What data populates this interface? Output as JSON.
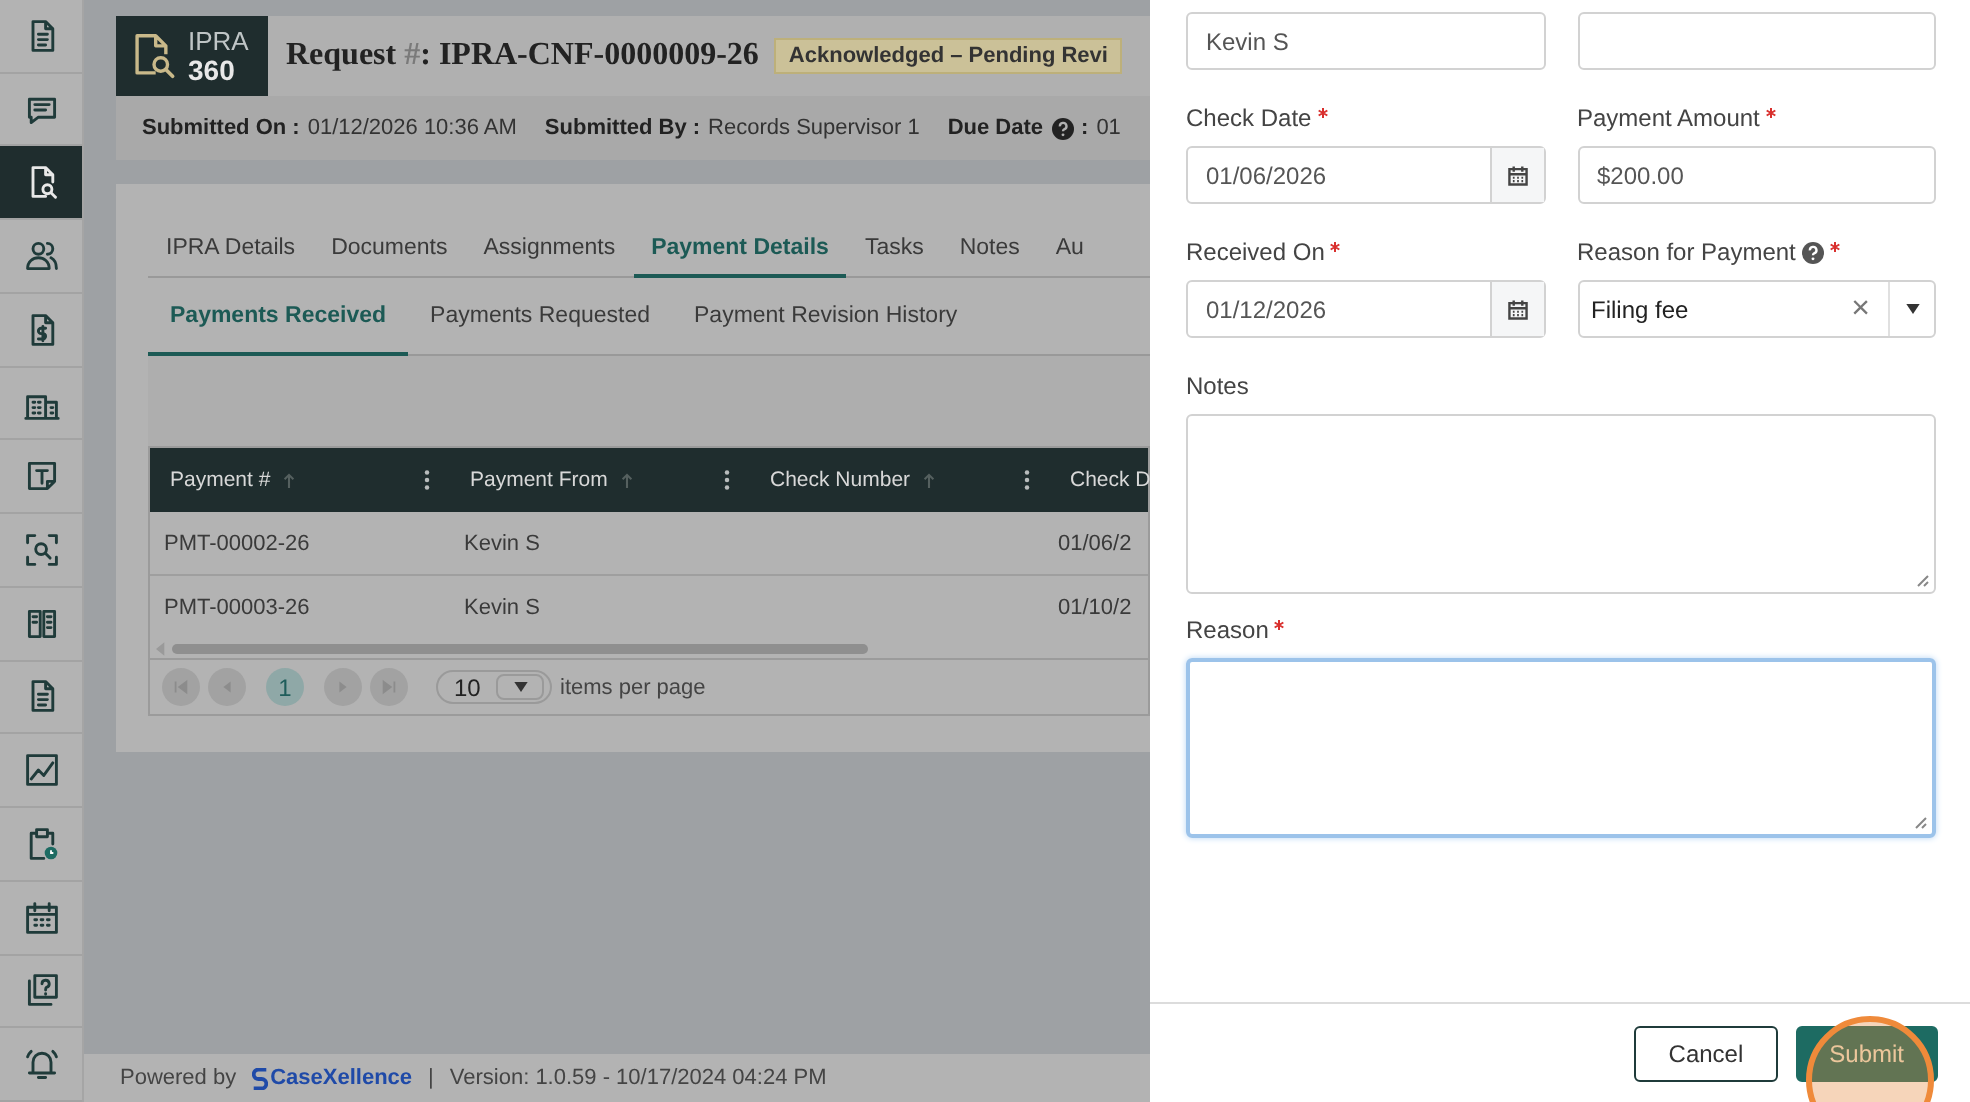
{
  "sidebar": {
    "items": [
      {
        "selected": false
      },
      {
        "selected": false
      },
      {
        "selected": true
      },
      {
        "selected": false
      },
      {
        "selected": false
      },
      {
        "selected": false
      },
      {
        "selected": false
      },
      {
        "selected": false
      },
      {
        "selected": false
      },
      {
        "selected": false
      },
      {
        "selected": false
      },
      {
        "selected": false
      },
      {
        "selected": false
      },
      {
        "selected": false
      },
      {
        "selected": false
      }
    ]
  },
  "header": {
    "logo": {
      "line1": "IPRA",
      "line2": "360"
    },
    "title_prefix": "Request ",
    "title_hash": "#",
    "title_value": ": IPRA-CNF-0000009-26",
    "status": "Acknowledged – Pending Revi"
  },
  "meta": [
    {
      "label": "Submitted On :",
      "value": "01/12/2026 10:36 AM",
      "help": false
    },
    {
      "label": "Submitted By :",
      "value": "Records Supervisor 1",
      "help": false
    },
    {
      "label": "Due Date",
      "suffix": ":",
      "value": "01",
      "help": true
    }
  ],
  "tabs": [
    {
      "label": "IPRA Details",
      "selected": false
    },
    {
      "label": "Documents",
      "selected": false
    },
    {
      "label": "Assignments",
      "selected": false
    },
    {
      "label": "Payment Details",
      "selected": true
    },
    {
      "label": "Tasks",
      "selected": false
    },
    {
      "label": "Notes",
      "selected": false
    },
    {
      "label": "Au",
      "selected": false
    }
  ],
  "subtabs": [
    {
      "label": "Payments Received",
      "selected": true
    },
    {
      "label": "Payments Requested",
      "selected": false
    },
    {
      "label": "Payment Revision History",
      "selected": false
    }
  ],
  "table": {
    "columns": [
      {
        "label": "Payment #"
      },
      {
        "label": "Payment From"
      },
      {
        "label": "Check Number"
      },
      {
        "label": "Check D"
      }
    ],
    "rows": [
      {
        "payment_no": "PMT-00002-26",
        "payment_from": "Kevin S",
        "column_4": "01/06/2"
      },
      {
        "payment_no": "PMT-00003-26",
        "payment_from": "Kevin S",
        "column_4": "01/10/2"
      }
    ]
  },
  "pager": {
    "pages": [
      {
        "label": "1",
        "selected": true
      }
    ],
    "page_size": "10",
    "page_size_label": "items per page"
  },
  "footer": {
    "powered_by": "Powered by",
    "brand": "CaseXellence",
    "separator": "|",
    "version": "Version: 1.0.59 - 10/17/2024 04:24 PM"
  },
  "drawer": {
    "fields": [
      {
        "kind": "text",
        "value": "Kevin S"
      },
      {
        "kind": "text"
      },
      {
        "kind": "date",
        "label": "Check Date",
        "required": true,
        "value": "01/06/2026"
      },
      {
        "kind": "text",
        "label": "Payment Amount",
        "required": true,
        "value": "$200.00"
      },
      {
        "kind": "date",
        "label": "Received On",
        "required": true,
        "value": "01/12/2026"
      },
      {
        "kind": "select",
        "label": "Reason for Payment",
        "help": true,
        "required": true,
        "value": "Filing fee",
        "clear": "×"
      },
      {
        "kind": "textarea",
        "label": "Notes",
        "required": false,
        "focused": false
      },
      {
        "kind": "textarea",
        "label": "Reason",
        "required": true,
        "focused": true
      }
    ],
    "buttons": [
      {
        "label": "Cancel",
        "kind": "outline",
        "highlighted": false
      },
      {
        "label": "Submit",
        "kind": "primary",
        "highlighted": true
      }
    ]
  }
}
